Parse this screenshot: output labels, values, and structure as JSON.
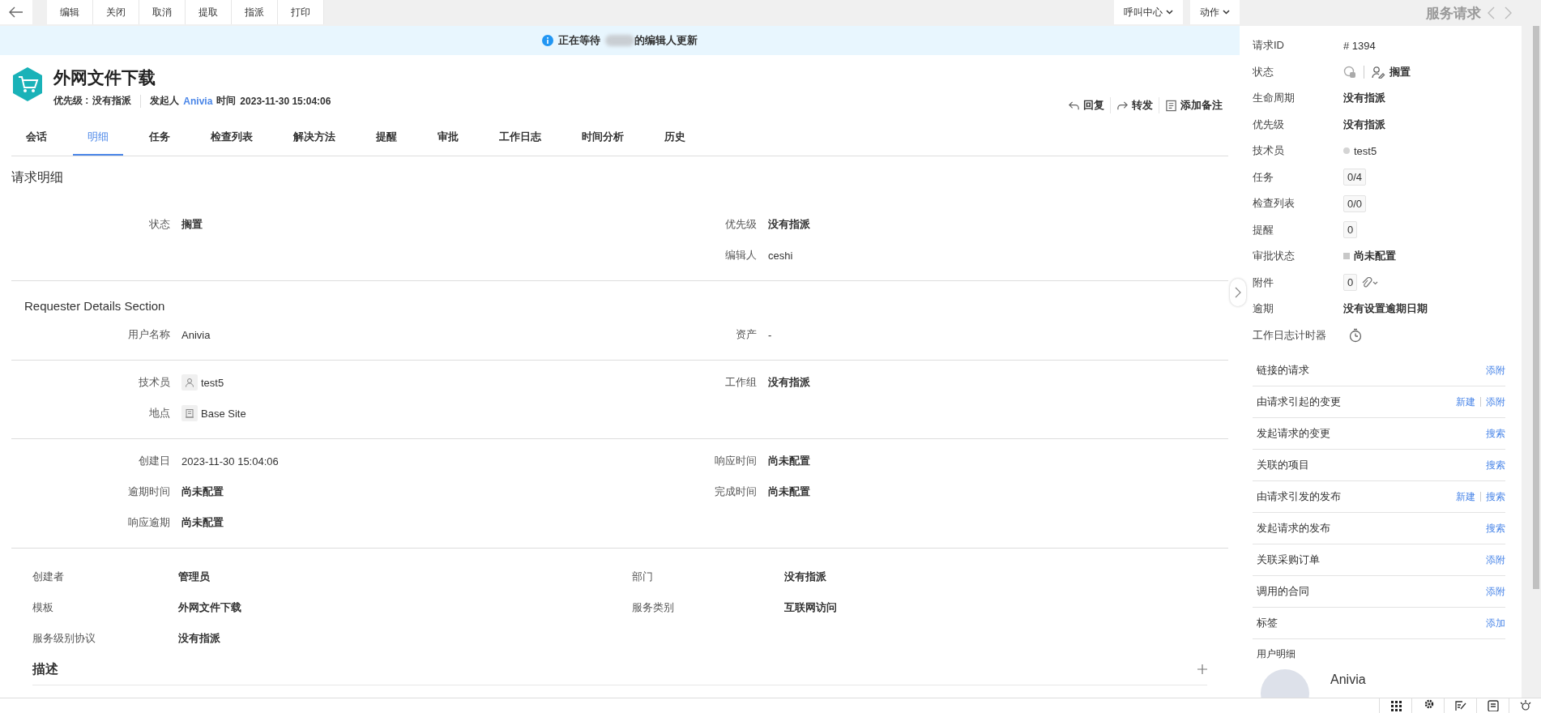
{
  "toolbar": {
    "buttons": [
      "编辑",
      "关闭",
      "取消",
      "提取",
      "指派",
      "打印"
    ],
    "menus": [
      "呼叫中心",
      "动作"
    ]
  },
  "banner": {
    "before": "正在等待",
    "after": "的编辑人更新"
  },
  "header": {
    "title": "外网文件下载",
    "priority_label": "优先级 :",
    "priority": "没有指派",
    "requester_label": "发起人",
    "requester": "Anivia",
    "time_label": "时间",
    "time": "2023-11-30 15:04:06",
    "actions": [
      {
        "kind": "reply",
        "label": "回复"
      },
      {
        "kind": "forward",
        "label": "转发"
      },
      {
        "kind": "note",
        "label": "添加备注"
      }
    ]
  },
  "tabs": [
    {
      "label": "会话",
      "selected": false
    },
    {
      "label": "明细",
      "selected": true
    },
    {
      "label": "任务",
      "selected": false
    },
    {
      "label": "检查列表",
      "selected": false
    },
    {
      "label": "解决方法",
      "selected": false
    },
    {
      "label": "提醒",
      "selected": false
    },
    {
      "label": "审批",
      "selected": false
    },
    {
      "label": "工作日志",
      "selected": false
    },
    {
      "label": "时间分析",
      "selected": false
    },
    {
      "label": "历史",
      "selected": false
    }
  ],
  "details": {
    "title": "请求明细",
    "sections": [
      {
        "rows": [
          [
            {
              "label": "状态",
              "value": "搁置",
              "bold": true,
              "kind": "text"
            },
            {
              "label": "优先级",
              "value": "没有指派",
              "bold": true,
              "kind": "text"
            }
          ],
          [
            null,
            {
              "label": "编辑人",
              "value": "ceshi",
              "bold": false,
              "kind": "text"
            }
          ]
        ]
      },
      {
        "title": "Requester Details Section",
        "rows": [
          [
            {
              "label": "用户名称",
              "value": "Anivia",
              "bold": false,
              "kind": "text"
            },
            {
              "label": "资产",
              "value": "-",
              "bold": false,
              "kind": "text"
            }
          ]
        ]
      },
      {
        "rows": [
          [
            {
              "label": "技术员",
              "value": "test5",
              "bold": false,
              "kind": "user"
            },
            {
              "label": "工作组",
              "value": "没有指派",
              "bold": true,
              "kind": "text"
            }
          ],
          [
            {
              "label": "地点",
              "value": "Base Site",
              "bold": false,
              "kind": "site"
            },
            null
          ]
        ]
      },
      {
        "rows": [
          [
            {
              "label": "创建日",
              "value": "2023-11-30 15:04:06",
              "bold": false,
              "kind": "text"
            },
            {
              "label": "响应时间",
              "value": "尚未配置",
              "bold": true,
              "kind": "text"
            }
          ],
          [
            {
              "label": "逾期时间",
              "value": "尚未配置",
              "bold": true,
              "kind": "text"
            },
            {
              "label": "完成时间",
              "value": "尚未配置",
              "bold": true,
              "kind": "text"
            }
          ],
          [
            {
              "label": "响应逾期",
              "value": "尚未配置",
              "bold": true,
              "kind": "text"
            },
            null
          ]
        ]
      }
    ]
  },
  "extra": {
    "rows": [
      [
        {
          "label": "创建者",
          "value": "管理员"
        },
        {
          "label": "部门",
          "value": "没有指派"
        }
      ],
      [
        {
          "label": "模板",
          "value": "外网文件下载"
        },
        {
          "label": "服务类别",
          "value": "互联网访问"
        }
      ],
      [
        {
          "label": "服务级别协议",
          "value": "没有指派"
        },
        null
      ]
    ],
    "description": "描述"
  },
  "side": {
    "title": "服务请求",
    "fields": [
      {
        "label": "请求ID",
        "kind": "text",
        "value": "# 1394",
        "bold": false
      },
      {
        "label": "状态",
        "kind": "status",
        "value": "搁置"
      },
      {
        "label": "生命周期",
        "kind": "text",
        "value": "没有指派",
        "bold": true
      },
      {
        "label": "优先级",
        "kind": "text",
        "value": "没有指派",
        "bold": true
      },
      {
        "label": "技术员",
        "kind": "dot",
        "value": "test5",
        "color": "#d4d4d4"
      },
      {
        "label": "任务",
        "kind": "count",
        "value": "0/4"
      },
      {
        "label": "检查列表",
        "kind": "count",
        "value": "0/0"
      },
      {
        "label": "提醒",
        "kind": "count",
        "value": "0"
      },
      {
        "label": "审批状态",
        "kind": "square",
        "value": "尚未配置",
        "color": "#c8c8c8"
      },
      {
        "label": "附件",
        "kind": "attachment",
        "value": "0"
      },
      {
        "label": "逾期",
        "kind": "text",
        "value": "没有设置逾期日期",
        "bold": true
      },
      {
        "label": "工作日志计时器",
        "kind": "timer"
      }
    ],
    "links": [
      {
        "label": "链接的请求",
        "actions": [
          "添附"
        ]
      },
      {
        "label": "由请求引起的变更",
        "actions": [
          "新建",
          "添附"
        ]
      },
      {
        "label": "发起请求的变更",
        "actions": [
          "搜索"
        ]
      },
      {
        "label": "关联的项目",
        "actions": [
          "搜索"
        ]
      },
      {
        "label": "由请求引发的发布",
        "actions": [
          "新建",
          "搜索"
        ]
      },
      {
        "label": "发起请求的发布",
        "actions": [
          "搜索"
        ]
      },
      {
        "label": "关联采购订单",
        "actions": [
          "添附"
        ]
      },
      {
        "label": "调用的合同",
        "actions": [
          "添附"
        ]
      },
      {
        "label": "标签",
        "actions": [
          "添加"
        ]
      }
    ],
    "user": {
      "title": "用户明细",
      "name": "Anivia"
    }
  }
}
